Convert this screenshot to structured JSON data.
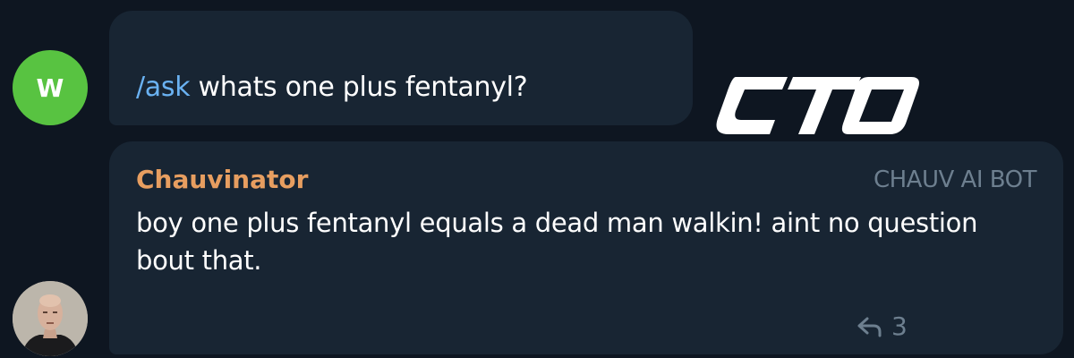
{
  "user_message": {
    "avatar_initial": "W",
    "command": "/ask",
    "text": " whats one plus fentanyl?"
  },
  "bot_message": {
    "sender": "Chauvinator",
    "badge": "CHAUV AI BOT",
    "text": "boy one plus fentanyl equals a dead man walkin! aint no question bout that.",
    "reply_count": "3"
  },
  "logo": {
    "text": "CTO"
  },
  "colors": {
    "background": "#0e1621",
    "bubble": "#182533",
    "avatar_w": "#58c341",
    "sender_name": "#e79e60",
    "command_link": "#6ab2f2",
    "muted": "#6d7f8f"
  },
  "icons": {
    "reply": "reply-arrow-icon"
  }
}
